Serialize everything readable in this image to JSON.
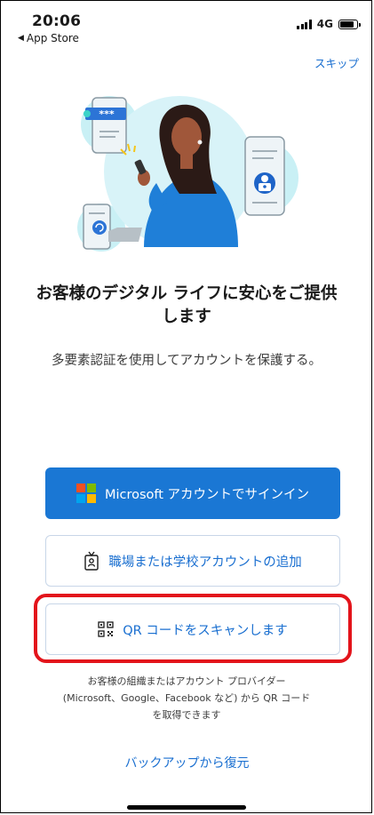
{
  "status_bar": {
    "time": "20:06",
    "back_app": "App Store",
    "network": "4G"
  },
  "skip_label": "スキップ",
  "hero": {
    "password_mask": "***"
  },
  "headline_line1": "お客様のデジタル ライフに安心をご提供",
  "headline_line2": "します",
  "subtext": "多要素認証を使用してアカウントを保護する。",
  "buttons": {
    "microsoft_signin": "Microsoft アカウントでサインイン",
    "work_school": "職場または学校アカウントの追加",
    "scan_qr": "QR コードをスキャンします"
  },
  "note_lines": [
    "お客様の組織またはアカウント プロバイダー",
    "(Microsoft、Google、Facebook など) から QR コード",
    "を取得できます"
  ],
  "restore_label": "バックアップから復元",
  "colors": {
    "accent": "#1a77d4",
    "link": "#1a6fd0",
    "highlight": "#e3141b",
    "ms_red": "#f25022",
    "ms_green": "#7fba00",
    "ms_blue": "#00a4ef",
    "ms_yellow": "#ffb900"
  },
  "icons": {
    "back": "back-triangle-icon",
    "signal": "signal-icon",
    "battery": "battery-icon",
    "microsoft": "microsoft-logo-icon",
    "badge": "id-badge-icon",
    "qr": "qr-code-icon"
  }
}
